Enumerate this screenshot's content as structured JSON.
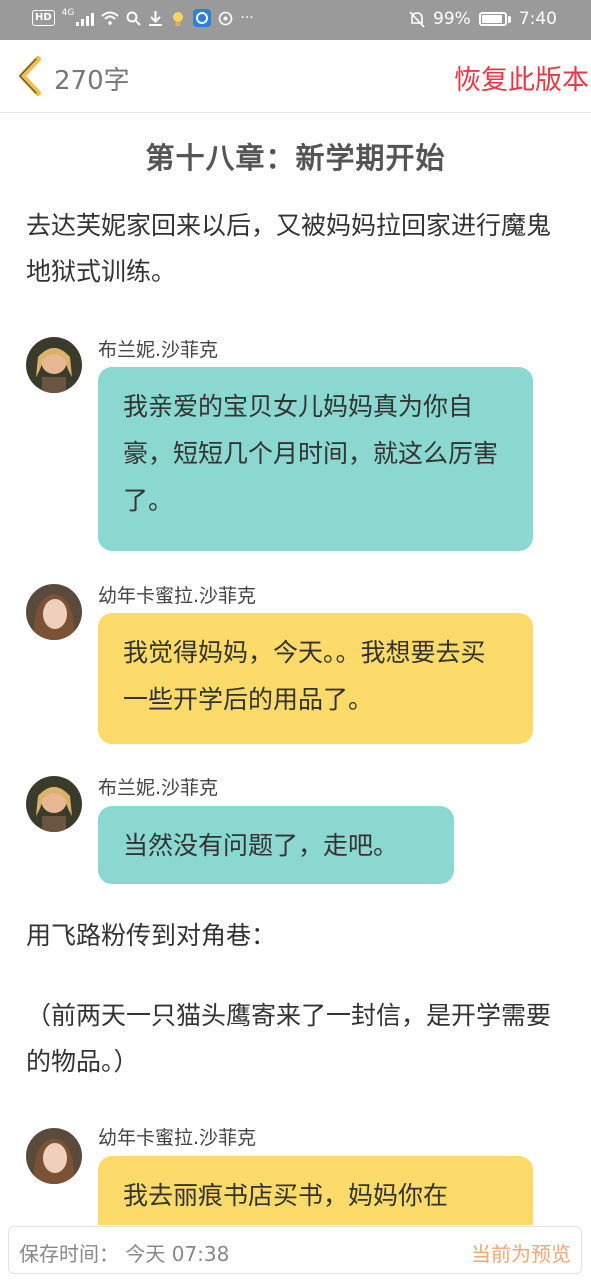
{
  "status_bar": {
    "hd_label": "HD",
    "network_label": "4G",
    "battery_percent_text": "99%",
    "battery_level": 0.99,
    "time": "7:40",
    "more_label": "···"
  },
  "nav": {
    "word_count": "270字",
    "restore_label": "恢复此版本"
  },
  "chapter": {
    "title": "第十八章：新学期开始",
    "paragraphs": [
      "去达芙妮家回来以后，又被妈妈拉回家进行魔鬼地狱式训练。",
      "用飞路粉传到对角巷：",
      "（前两天一只猫头鹰寄来了一封信，是开学需要的物品。）"
    ]
  },
  "messages": [
    {
      "sender": "布兰妮.沙菲克",
      "text": "我亲爱的宝贝女儿妈妈真为你自豪，短短几个月时间，就这么厉害了。",
      "color": "#8ad8d0"
    },
    {
      "sender": "幼年卡蜜拉.沙菲克",
      "text": "我觉得妈妈，今天。。我想要去买一些开学后的用品了。",
      "color": "#fddb6a"
    },
    {
      "sender": "布兰妮.沙菲克",
      "text": "当然没有问题了，走吧。",
      "color": "#8ad8d0"
    },
    {
      "sender": "幼年卡蜜拉.沙菲克",
      "text": "我去丽痕书店买书，妈妈你在",
      "color": "#fddb6a"
    }
  ],
  "bottom": {
    "save_time": "保存时间：  今天 07:38",
    "preview_label": "当前为预览"
  },
  "colors": {
    "accent_red": "#e43a47",
    "teal_bubble": "#8ad8d0",
    "yellow_bubble": "#fddb6a",
    "back_arrow": "#f2c04a"
  }
}
